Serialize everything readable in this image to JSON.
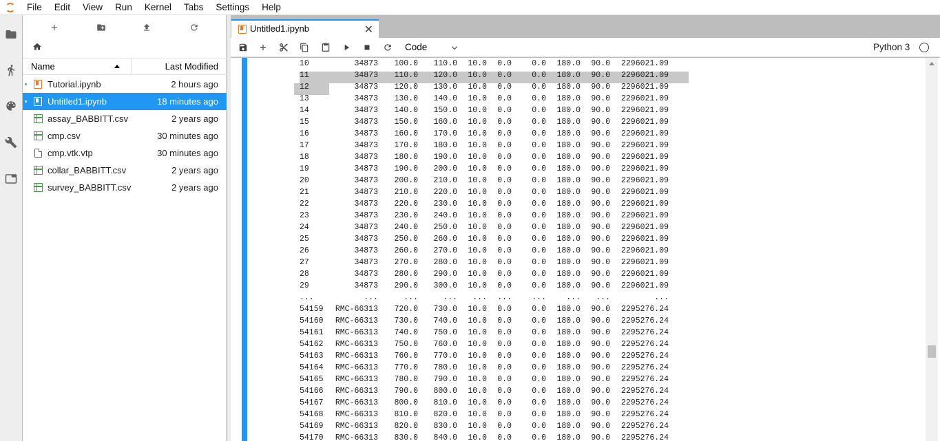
{
  "menu": [
    "File",
    "Edit",
    "View",
    "Run",
    "Kernel",
    "Tabs",
    "Settings",
    "Help"
  ],
  "filebrowser": {
    "col_name": "Name",
    "col_modified": "Last Modified",
    "files": [
      {
        "name": "Tutorial.ipynb",
        "modified": "2 hours ago",
        "type": "notebook",
        "running": true,
        "selected": false
      },
      {
        "name": "Untitled1.ipynb",
        "modified": "18 minutes ago",
        "type": "notebook",
        "running": true,
        "selected": true
      },
      {
        "name": "assay_BABBITT.csv",
        "modified": "2 years ago",
        "type": "csv",
        "running": false,
        "selected": false
      },
      {
        "name": "cmp.csv",
        "modified": "30 minutes ago",
        "type": "csv",
        "running": false,
        "selected": false
      },
      {
        "name": "cmp.vtk.vtp",
        "modified": "30 minutes ago",
        "type": "file",
        "running": false,
        "selected": false
      },
      {
        "name": "collar_BABBITT.csv",
        "modified": "2 years ago",
        "type": "csv",
        "running": false,
        "selected": false
      },
      {
        "name": "survey_BABBITT.csv",
        "modified": "2 years ago",
        "type": "csv",
        "running": false,
        "selected": false
      }
    ]
  },
  "tab": {
    "label": "Untitled1.ipynb",
    "close": "✕"
  },
  "toolbar": {
    "cell_type": "Code",
    "kernel": "Python 3"
  },
  "output_rows": [
    [
      "10",
      "34873",
      "100.0",
      "110.0",
      "10.0",
      "0.0",
      "0.0",
      "180.0",
      "90.0",
      "2296021.09"
    ],
    [
      "11",
      "34873",
      "110.0",
      "120.0",
      "10.0",
      "0.0",
      "0.0",
      "180.0",
      "90.0",
      "2296021.09"
    ],
    [
      "12",
      "34873",
      "120.0",
      "130.0",
      "10.0",
      "0.0",
      "0.0",
      "180.0",
      "90.0",
      "2296021.09"
    ],
    [
      "13",
      "34873",
      "130.0",
      "140.0",
      "10.0",
      "0.0",
      "0.0",
      "180.0",
      "90.0",
      "2296021.09"
    ],
    [
      "14",
      "34873",
      "140.0",
      "150.0",
      "10.0",
      "0.0",
      "0.0",
      "180.0",
      "90.0",
      "2296021.09"
    ],
    [
      "15",
      "34873",
      "150.0",
      "160.0",
      "10.0",
      "0.0",
      "0.0",
      "180.0",
      "90.0",
      "2296021.09"
    ],
    [
      "16",
      "34873",
      "160.0",
      "170.0",
      "10.0",
      "0.0",
      "0.0",
      "180.0",
      "90.0",
      "2296021.09"
    ],
    [
      "17",
      "34873",
      "170.0",
      "180.0",
      "10.0",
      "0.0",
      "0.0",
      "180.0",
      "90.0",
      "2296021.09"
    ],
    [
      "18",
      "34873",
      "180.0",
      "190.0",
      "10.0",
      "0.0",
      "0.0",
      "180.0",
      "90.0",
      "2296021.09"
    ],
    [
      "19",
      "34873",
      "190.0",
      "200.0",
      "10.0",
      "0.0",
      "0.0",
      "180.0",
      "90.0",
      "2296021.09"
    ],
    [
      "20",
      "34873",
      "200.0",
      "210.0",
      "10.0",
      "0.0",
      "0.0",
      "180.0",
      "90.0",
      "2296021.09"
    ],
    [
      "21",
      "34873",
      "210.0",
      "220.0",
      "10.0",
      "0.0",
      "0.0",
      "180.0",
      "90.0",
      "2296021.09"
    ],
    [
      "22",
      "34873",
      "220.0",
      "230.0",
      "10.0",
      "0.0",
      "0.0",
      "180.0",
      "90.0",
      "2296021.09"
    ],
    [
      "23",
      "34873",
      "230.0",
      "240.0",
      "10.0",
      "0.0",
      "0.0",
      "180.0",
      "90.0",
      "2296021.09"
    ],
    [
      "24",
      "34873",
      "240.0",
      "250.0",
      "10.0",
      "0.0",
      "0.0",
      "180.0",
      "90.0",
      "2296021.09"
    ],
    [
      "25",
      "34873",
      "250.0",
      "260.0",
      "10.0",
      "0.0",
      "0.0",
      "180.0",
      "90.0",
      "2296021.09"
    ],
    [
      "26",
      "34873",
      "260.0",
      "270.0",
      "10.0",
      "0.0",
      "0.0",
      "180.0",
      "90.0",
      "2296021.09"
    ],
    [
      "27",
      "34873",
      "270.0",
      "280.0",
      "10.0",
      "0.0",
      "0.0",
      "180.0",
      "90.0",
      "2296021.09"
    ],
    [
      "28",
      "34873",
      "280.0",
      "290.0",
      "10.0",
      "0.0",
      "0.0",
      "180.0",
      "90.0",
      "2296021.09"
    ],
    [
      "29",
      "34873",
      "290.0",
      "300.0",
      "10.0",
      "0.0",
      "0.0",
      "180.0",
      "90.0",
      "2296021.09"
    ],
    [
      "...",
      "...",
      "...",
      "...",
      "...",
      "...",
      "...",
      "...",
      "...",
      "..."
    ],
    [
      "54159",
      "RMC-66313",
      "720.0",
      "730.0",
      "10.0",
      "0.0",
      "0.0",
      "180.0",
      "90.0",
      "2295276.24"
    ],
    [
      "54160",
      "RMC-66313",
      "730.0",
      "740.0",
      "10.0",
      "0.0",
      "0.0",
      "180.0",
      "90.0",
      "2295276.24"
    ],
    [
      "54161",
      "RMC-66313",
      "740.0",
      "750.0",
      "10.0",
      "0.0",
      "0.0",
      "180.0",
      "90.0",
      "2295276.24"
    ],
    [
      "54162",
      "RMC-66313",
      "750.0",
      "760.0",
      "10.0",
      "0.0",
      "0.0",
      "180.0",
      "90.0",
      "2295276.24"
    ],
    [
      "54163",
      "RMC-66313",
      "760.0",
      "770.0",
      "10.0",
      "0.0",
      "0.0",
      "180.0",
      "90.0",
      "2295276.24"
    ],
    [
      "54164",
      "RMC-66313",
      "770.0",
      "780.0",
      "10.0",
      "0.0",
      "0.0",
      "180.0",
      "90.0",
      "2295276.24"
    ],
    [
      "54165",
      "RMC-66313",
      "780.0",
      "790.0",
      "10.0",
      "0.0",
      "0.0",
      "180.0",
      "90.0",
      "2295276.24"
    ],
    [
      "54166",
      "RMC-66313",
      "790.0",
      "800.0",
      "10.0",
      "0.0",
      "0.0",
      "180.0",
      "90.0",
      "2295276.24"
    ],
    [
      "54167",
      "RMC-66313",
      "800.0",
      "810.0",
      "10.0",
      "0.0",
      "0.0",
      "180.0",
      "90.0",
      "2295276.24"
    ],
    [
      "54168",
      "RMC-66313",
      "810.0",
      "820.0",
      "10.0",
      "0.0",
      "0.0",
      "180.0",
      "90.0",
      "2295276.24"
    ],
    [
      "54169",
      "RMC-66313",
      "820.0",
      "830.0",
      "10.0",
      "0.0",
      "0.0",
      "180.0",
      "90.0",
      "2295276.24"
    ],
    [
      "54170",
      "RMC-66313",
      "830.0",
      "840.0",
      "10.0",
      "0.0",
      "0.0",
      "180.0",
      "90.0",
      "2295276.24"
    ]
  ]
}
